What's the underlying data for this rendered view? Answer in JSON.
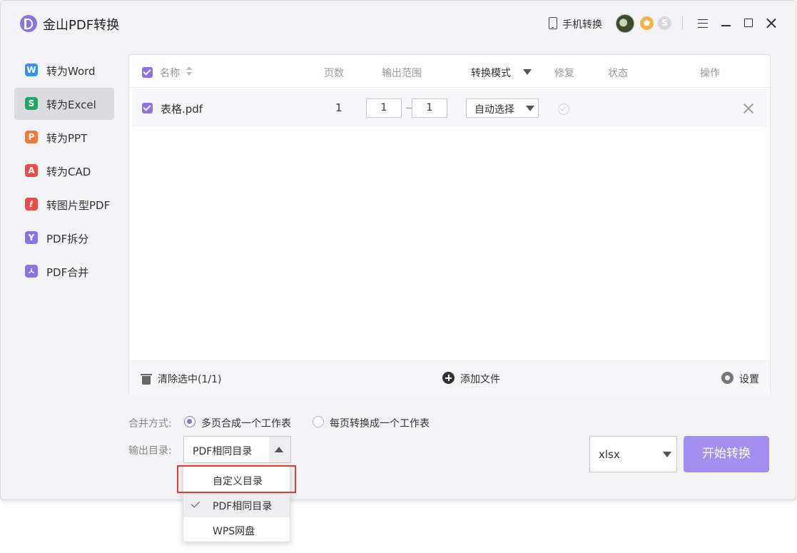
{
  "app": {
    "title": "金山PDF转换",
    "logo_icon": "pdf-logo-icon"
  },
  "titlebar": {
    "mobile_convert_label": "手机转换",
    "coin_glyph": "S"
  },
  "sidebar": {
    "items": [
      {
        "label": "转为Word",
        "glyph": "W",
        "color": "#3a8ef0",
        "active": false
      },
      {
        "label": "转为Excel",
        "glyph": "S",
        "color": "#22a565",
        "active": true
      },
      {
        "label": "转为PPT",
        "glyph": "P",
        "color": "#f2783d",
        "active": false
      },
      {
        "label": "转为CAD",
        "glyph": "A",
        "color": "#ea4b4b",
        "active": false
      },
      {
        "label": "转图片型PDF",
        "glyph": "ℓ",
        "color": "#ea4b4b",
        "active": false
      },
      {
        "label": "PDF拆分",
        "glyph": "Y",
        "color": "#8b73e6",
        "active": false
      },
      {
        "label": "PDF合并",
        "glyph": "ㅅ",
        "color": "#8b73e6",
        "active": false
      }
    ]
  },
  "table": {
    "headers": {
      "name": "名称",
      "pages": "页数",
      "range": "输出范围",
      "mode": "转换模式",
      "repair": "修复",
      "status": "状态",
      "action": "操作"
    },
    "rows": [
      {
        "checked": true,
        "name": "表格.pdf",
        "pages": "1",
        "range_from": "1",
        "range_to": "1",
        "mode": "自动选择",
        "status": ""
      }
    ]
  },
  "footer": {
    "clear_label": "清除选中(1/1)",
    "add_label": "添加文件",
    "settings_label": "设置"
  },
  "options": {
    "merge_label": "合并方式:",
    "merge_options": [
      "多页合成一个工作表",
      "每页转换成一个工作表"
    ],
    "merge_selected": 0,
    "output_label": "输出目录:",
    "output_value": "PDF相同目录",
    "output_options": [
      "自定义目录",
      "PDF相同目录",
      "WPS网盘"
    ],
    "output_selected": 1
  },
  "format": {
    "value": "xlsx"
  },
  "start_button": {
    "label": "开始转换"
  },
  "colors": {
    "accent": "#8b73e6",
    "start_button": "#a48ef0",
    "highlight": "#e53935"
  }
}
